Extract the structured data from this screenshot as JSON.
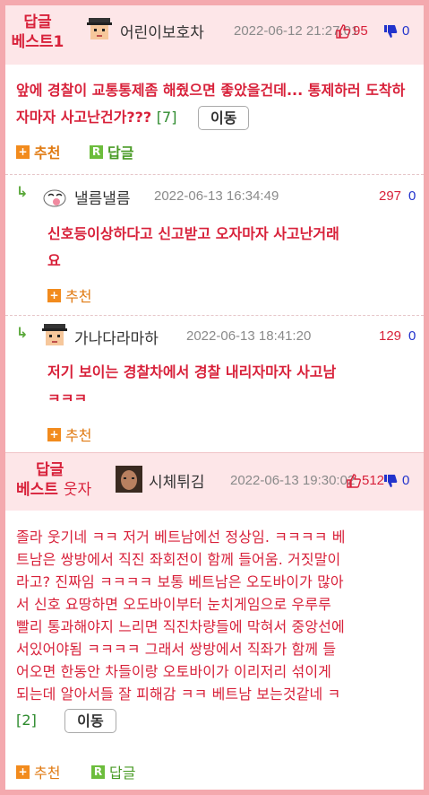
{
  "best1": {
    "badge_line1": "답글",
    "badge_line2": "베스트1",
    "nickname": "어린이보호차",
    "date": "2022-06-12 21:27:01",
    "up": "95",
    "down": "0",
    "text": "앞에 경찰이 교통통제좀 해줬으면 좋았을건데... 통제하러 도착하자마자 사고난건가???",
    "comment_count": "[7]",
    "move_label": "이동",
    "recommend_label": "추천",
    "reply_label": "답글"
  },
  "reply1": {
    "nickname": "낼름낼름",
    "date": "2022-06-13 16:34:49",
    "up": "297",
    "down": "0",
    "text_line1": "신호등이상하다고 신고받고 오자마자 사고난거래",
    "text_line2": "요",
    "recommend_label": "추천"
  },
  "reply2": {
    "nickname": "가나다라마하",
    "date": "2022-06-13 18:41:20",
    "up": "129",
    "down": "0",
    "text_line1": "저기 보이는 경찰차에서 경찰 내리자마자 사고남",
    "text_line2": "ㅋㅋㅋ",
    "recommend_label": "추천"
  },
  "best2": {
    "badge_line1": "답글",
    "badge_line2": "베스트",
    "badge_sub": "웃자",
    "nickname": "시체튀김",
    "date": "2022-06-13 19:30:02",
    "up": "512",
    "down": "0",
    "lines": [
      "졸라 웃기네 ㅋㅋ 저거 베트남에선 정상임. ㅋㅋㅋㅋ 베",
      "트남은 쌍방에서 직진 좌회전이 함께 들어움. 거짓말이",
      "라고? 진짜임 ㅋㅋㅋㅋ 보통 베트남은 오도바이가 많아",
      "서 신호 요땅하면 오도바이부터 눈치게임으로 우루루",
      "빨리 통과해야지 느리면 직진차량들에 막혀서 중앙선에",
      "서있어야됨 ㅋㅋㅋㅋ 그래서 쌍방에서 직좌가 함께 들",
      "어오면 한동안 차들이랑 오토바이가 이리저리 섞이게",
      "되는데 알아서들 잘 피해감 ㅋㅋ 베트남 보는것같네 ㅋ"
    ],
    "comment_count": "[2]",
    "move_label": "이동",
    "recommend_label": "추천",
    "reply_label": "답글"
  },
  "icons": {
    "recommend_glyph": "+",
    "reply_glyph": "R",
    "reply_arrow_glyph": "↳"
  },
  "colors": {
    "accent_red": "#d8213a",
    "frame_pink": "#f4a9ae",
    "header_pink": "#fde6e8"
  }
}
